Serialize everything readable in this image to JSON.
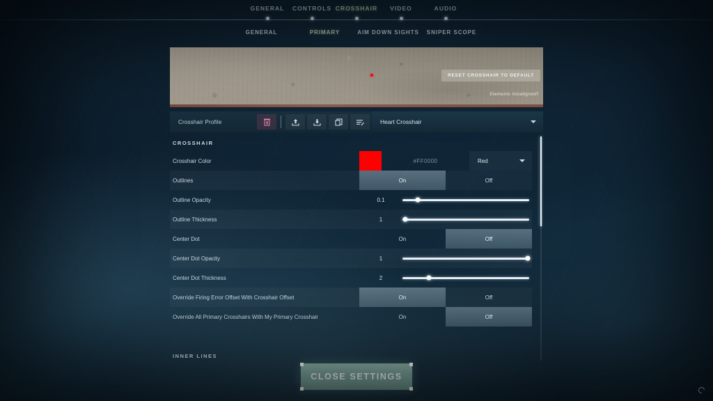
{
  "nav": {
    "main_tabs": [
      {
        "label": "GENERAL",
        "active": false
      },
      {
        "label": "CONTROLS",
        "active": false
      },
      {
        "label": "CROSSHAIR",
        "active": true
      },
      {
        "label": "VIDEO",
        "active": false
      },
      {
        "label": "AUDIO",
        "active": false
      }
    ],
    "sub_tabs": [
      {
        "label": "GENERAL",
        "active": false
      },
      {
        "label": "PRIMARY",
        "active": true
      },
      {
        "label": "AIM DOWN SIGHTS",
        "active": false
      },
      {
        "label": "SNIPER SCOPE",
        "active": false
      }
    ]
  },
  "preview": {
    "reset_button": "RESET CROSSHAIR TO DEFAULT",
    "misaligned_link": "Elements misaligned?",
    "crosshair_color": "#FF0000"
  },
  "profile": {
    "label": "Crosshair Profile",
    "selected": "Heart Crosshair",
    "icons": [
      "delete-icon",
      "upload-icon",
      "download-icon",
      "copy-icon",
      "edit-icon"
    ]
  },
  "sections": [
    {
      "header": "CROSSHAIR",
      "rows": [
        {
          "label": "Crosshair Color",
          "type": "color",
          "swatch": "#FF0000",
          "hex": "#FF0000",
          "preset": "Red"
        },
        {
          "label": "Outlines",
          "type": "toggle",
          "options": [
            "On",
            "Off"
          ],
          "selected": "On"
        },
        {
          "label": "Outline Opacity",
          "type": "slider",
          "value": "0.1",
          "percent": 12
        },
        {
          "label": "Outline Thickness",
          "type": "slider",
          "value": "1",
          "percent": 2
        },
        {
          "label": "Center Dot",
          "type": "toggle",
          "options": [
            "On",
            "Off"
          ],
          "selected": "Off"
        },
        {
          "label": "Center Dot Opacity",
          "type": "slider",
          "value": "1",
          "percent": 99
        },
        {
          "label": "Center Dot Thickness",
          "type": "slider",
          "value": "2",
          "percent": 21
        },
        {
          "label": "Override Firing Error Offset With Crosshair Offset",
          "type": "toggle",
          "options": [
            "On",
            "Off"
          ],
          "selected": "On"
        },
        {
          "label": "Override All Primary Crosshairs With My Primary Crosshair",
          "type": "toggle",
          "options": [
            "On",
            "Off"
          ],
          "selected": "Off"
        }
      ]
    },
    {
      "header": "INNER LINES",
      "rows": []
    }
  ],
  "footer": {
    "close_label": "CLOSE SETTINGS"
  },
  "colors": {
    "accent_green": "#b8cfae",
    "crosshair_red": "#FF0000",
    "close_button": "#7fa9a0"
  }
}
